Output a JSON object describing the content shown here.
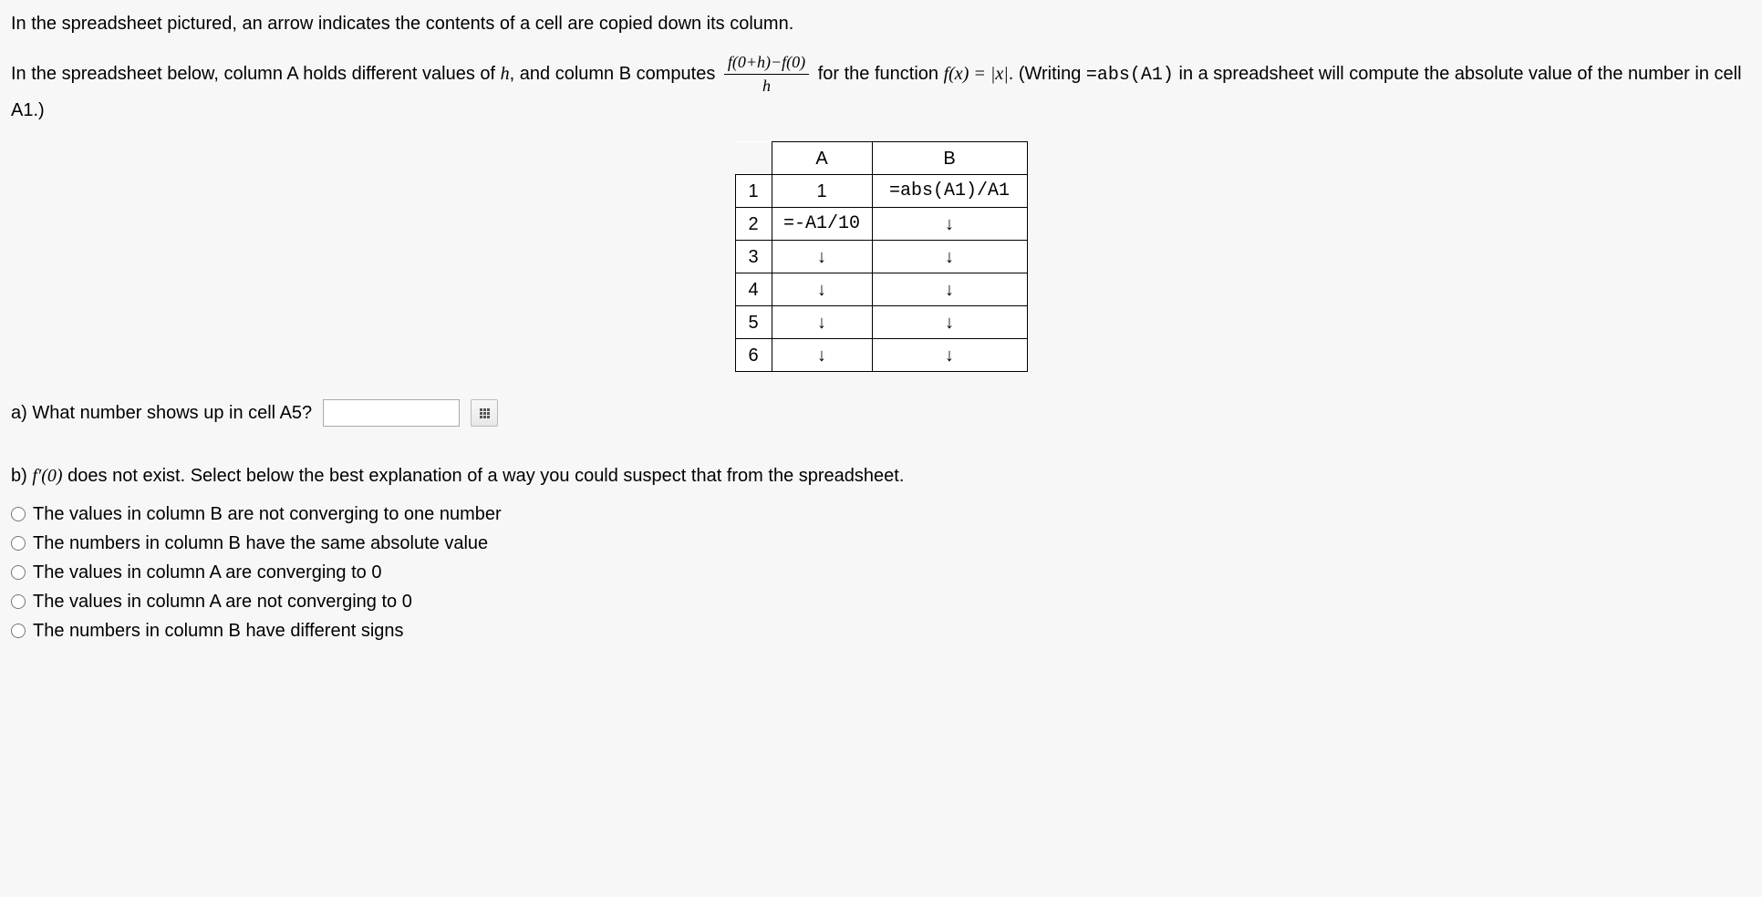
{
  "intro": {
    "line1": "In the spreadsheet pictured, an arrow indicates the contents of a cell are copied down its column.",
    "line2_pre": "In the spreadsheet below, column A holds different values of ",
    "h": "h",
    "line2_mid": ", and column B computes ",
    "frac_num": "f(0+h)−f(0)",
    "frac_den": "h",
    "line2_after": " for the function ",
    "func": "f(x) = |x|",
    "line2_writing": ". (Writing ",
    "abs_code": "=abs(A1)",
    "line2_end": " in a spreadsheet will compute the absolute value of the number in cell A1.)"
  },
  "table": {
    "colA_header": "A",
    "colB_header": "B",
    "rows": [
      {
        "num": "1",
        "a": "1",
        "b": "=abs(A1)/A1"
      },
      {
        "num": "2",
        "a": "=-A1/10",
        "b": "↓"
      },
      {
        "num": "3",
        "a": "↓",
        "b": "↓"
      },
      {
        "num": "4",
        "a": "↓",
        "b": "↓"
      },
      {
        "num": "5",
        "a": "↓",
        "b": "↓"
      },
      {
        "num": "6",
        "a": "↓",
        "b": "↓"
      }
    ]
  },
  "qa": {
    "label": "a) What number shows up in cell A5?"
  },
  "qb": {
    "prefix": "b) ",
    "fprime": "f′(0)",
    "rest": " does not exist. Select below the best explanation of a way you could suspect that from the spreadsheet.",
    "options": [
      "The values in column B are not converging to one number",
      "The numbers in column B have the same absolute value",
      "The values in column A are converging to 0",
      "The values in column A are not converging to 0",
      "The numbers in column B have different signs"
    ]
  }
}
